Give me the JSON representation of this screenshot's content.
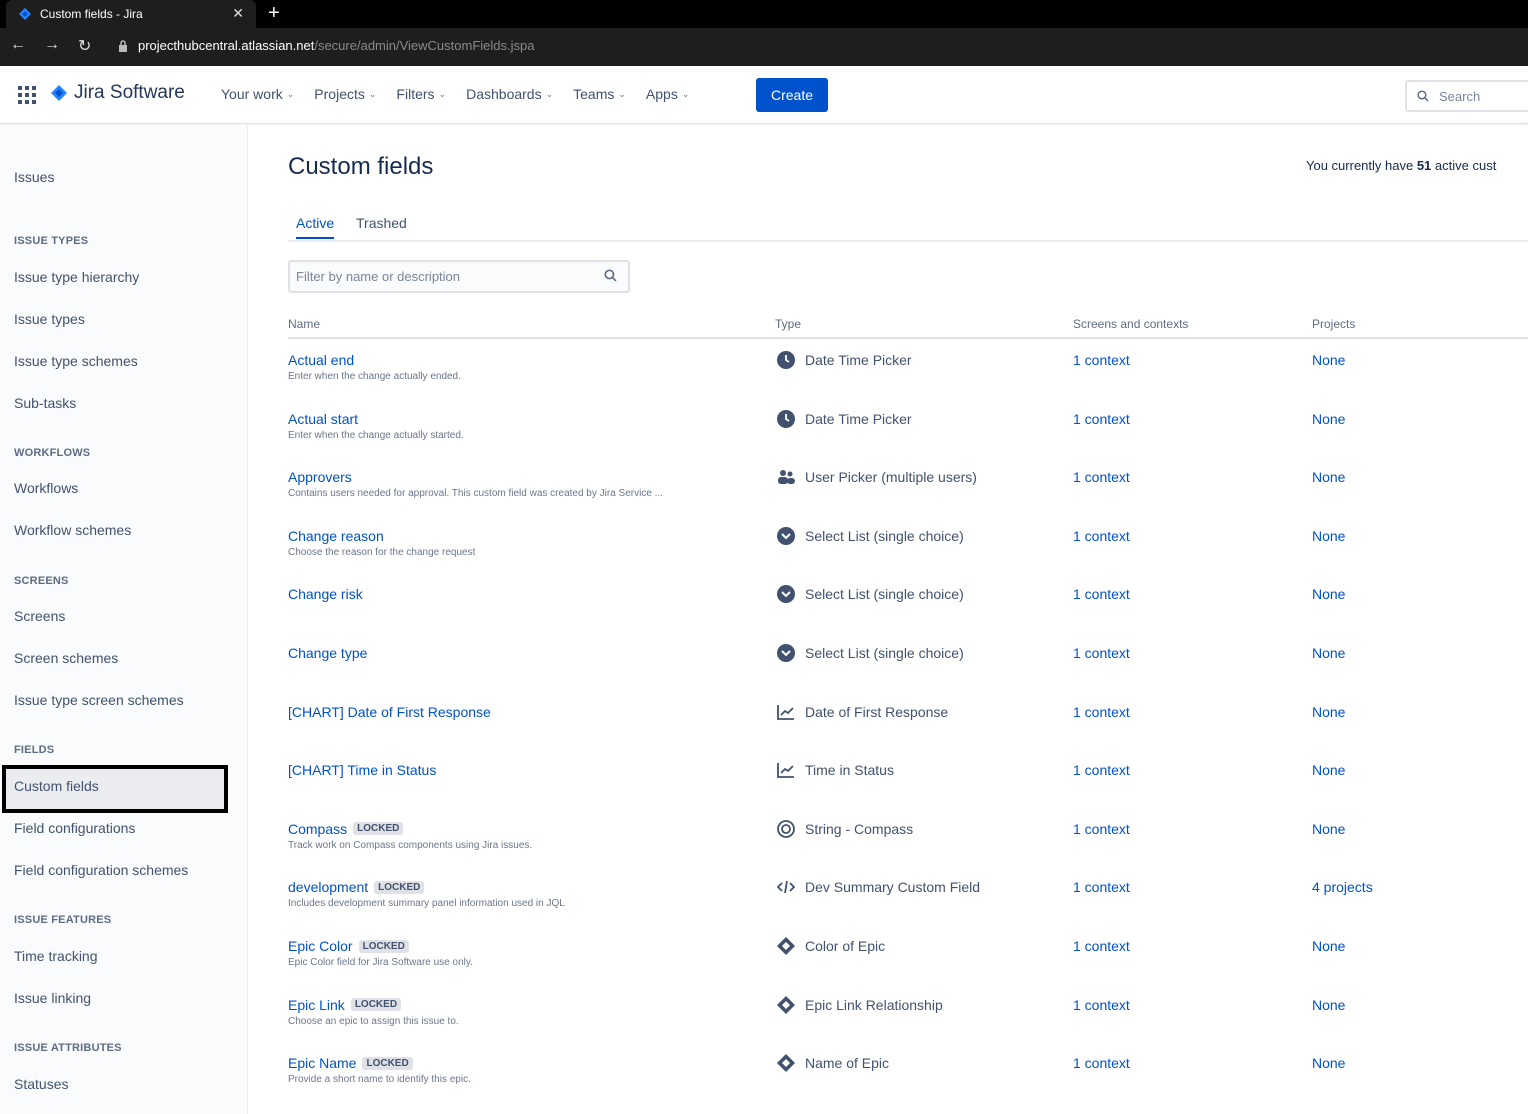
{
  "browser": {
    "tab_title": "Custom fields - Jira",
    "url_host": "projecthubcentral.atlassian.net",
    "url_path": "/secure/admin/ViewCustomFields.jspa"
  },
  "header": {
    "product": "Jira Software",
    "menu": [
      "Your work",
      "Projects",
      "Filters",
      "Dashboards",
      "Teams",
      "Apps"
    ],
    "create_label": "Create",
    "search_placeholder": "Search"
  },
  "sidebar": {
    "top": "Issues",
    "sections": {
      "issue_types": "ISSUE TYPES",
      "workflows": "WORKFLOWS",
      "screens": "SCREENS",
      "fields": "FIELDS",
      "issue_features": "ISSUE FEATURES",
      "issue_attributes": "ISSUE ATTRIBUTES"
    },
    "items": {
      "issue_type_hierarchy": "Issue type hierarchy",
      "issue_types": "Issue types",
      "issue_type_schemes": "Issue type schemes",
      "sub_tasks": "Sub-tasks",
      "workflows": "Workflows",
      "workflow_schemes": "Workflow schemes",
      "screens": "Screens",
      "screen_schemes": "Screen schemes",
      "issue_type_screen_schemes": "Issue type screen schemes",
      "custom_fields": "Custom fields",
      "field_configurations": "Field configurations",
      "field_configuration_schemes": "Field configuration schemes",
      "time_tracking": "Time tracking",
      "issue_linking": "Issue linking",
      "statuses": "Statuses"
    }
  },
  "main": {
    "title": "Custom fields",
    "summary_prefix": "You currently have ",
    "summary_count": "51",
    "summary_suffix": " active cust",
    "tabs": [
      "Active",
      "Trashed"
    ],
    "filter_placeholder": "Filter by name or description",
    "columns": [
      "Name",
      "Type",
      "Screens and contexts",
      "Projects"
    ],
    "rows": [
      {
        "name": "Actual end",
        "locked": "",
        "desc": "Enter when the change actually ended.",
        "type": "Date Time Picker",
        "icon": "clock-icon",
        "ctx": "1 context",
        "proj": "None"
      },
      {
        "name": "Actual start",
        "locked": "",
        "desc": "Enter when the change actually started.",
        "type": "Date Time Picker",
        "icon": "clock-icon",
        "ctx": "1 context",
        "proj": "None"
      },
      {
        "name": "Approvers",
        "locked": "",
        "desc": "Contains users needed for approval. This custom field was created by Jira Service ...",
        "type": "User Picker (multiple users)",
        "icon": "users-icon",
        "ctx": "1 context",
        "proj": "None"
      },
      {
        "name": "Change reason",
        "locked": "",
        "desc": "Choose the reason for the change request",
        "type": "Select List (single choice)",
        "icon": "select-icon",
        "ctx": "1 context",
        "proj": "None"
      },
      {
        "name": "Change risk",
        "locked": "",
        "desc": "",
        "type": "Select List (single choice)",
        "icon": "select-icon",
        "ctx": "1 context",
        "proj": "None"
      },
      {
        "name": "Change type",
        "locked": "",
        "desc": "",
        "type": "Select List (single choice)",
        "icon": "select-icon",
        "ctx": "1 context",
        "proj": "None"
      },
      {
        "name": "[CHART] Date of First Response",
        "locked": "",
        "desc": "",
        "type": "Date of First Response",
        "icon": "chart-icon",
        "ctx": "1 context",
        "proj": "None"
      },
      {
        "name": "[CHART] Time in Status",
        "locked": "",
        "desc": "",
        "type": "Time in Status",
        "icon": "chart-icon",
        "ctx": "1 context",
        "proj": "None"
      },
      {
        "name": "Compass",
        "locked": "LOCKED",
        "desc": "Track work on Compass components using Jira issues.",
        "type": "String - Compass",
        "icon": "compass-icon",
        "ctx": "1 context",
        "proj": "None"
      },
      {
        "name": "development",
        "locked": "LOCKED",
        "desc": "Includes development summary panel information used in JQL",
        "type": "Dev Summary Custom Field",
        "icon": "code-icon",
        "ctx": "1 context",
        "proj": "4 projects"
      },
      {
        "name": "Epic Color",
        "locked": "LOCKED",
        "desc": "Epic Color field for Jira Software use only.",
        "type": "Color of Epic",
        "icon": "diamond-icon",
        "ctx": "1 context",
        "proj": "None"
      },
      {
        "name": "Epic Link",
        "locked": "LOCKED",
        "desc": "Choose an epic to assign this issue to.",
        "type": "Epic Link Relationship",
        "icon": "diamond-icon",
        "ctx": "1 context",
        "proj": "None"
      },
      {
        "name": "Epic Name",
        "locked": "LOCKED",
        "desc": "Provide a short name to identify this epic.",
        "type": "Name of Epic",
        "icon": "diamond-icon",
        "ctx": "1 context",
        "proj": "None"
      }
    ]
  }
}
